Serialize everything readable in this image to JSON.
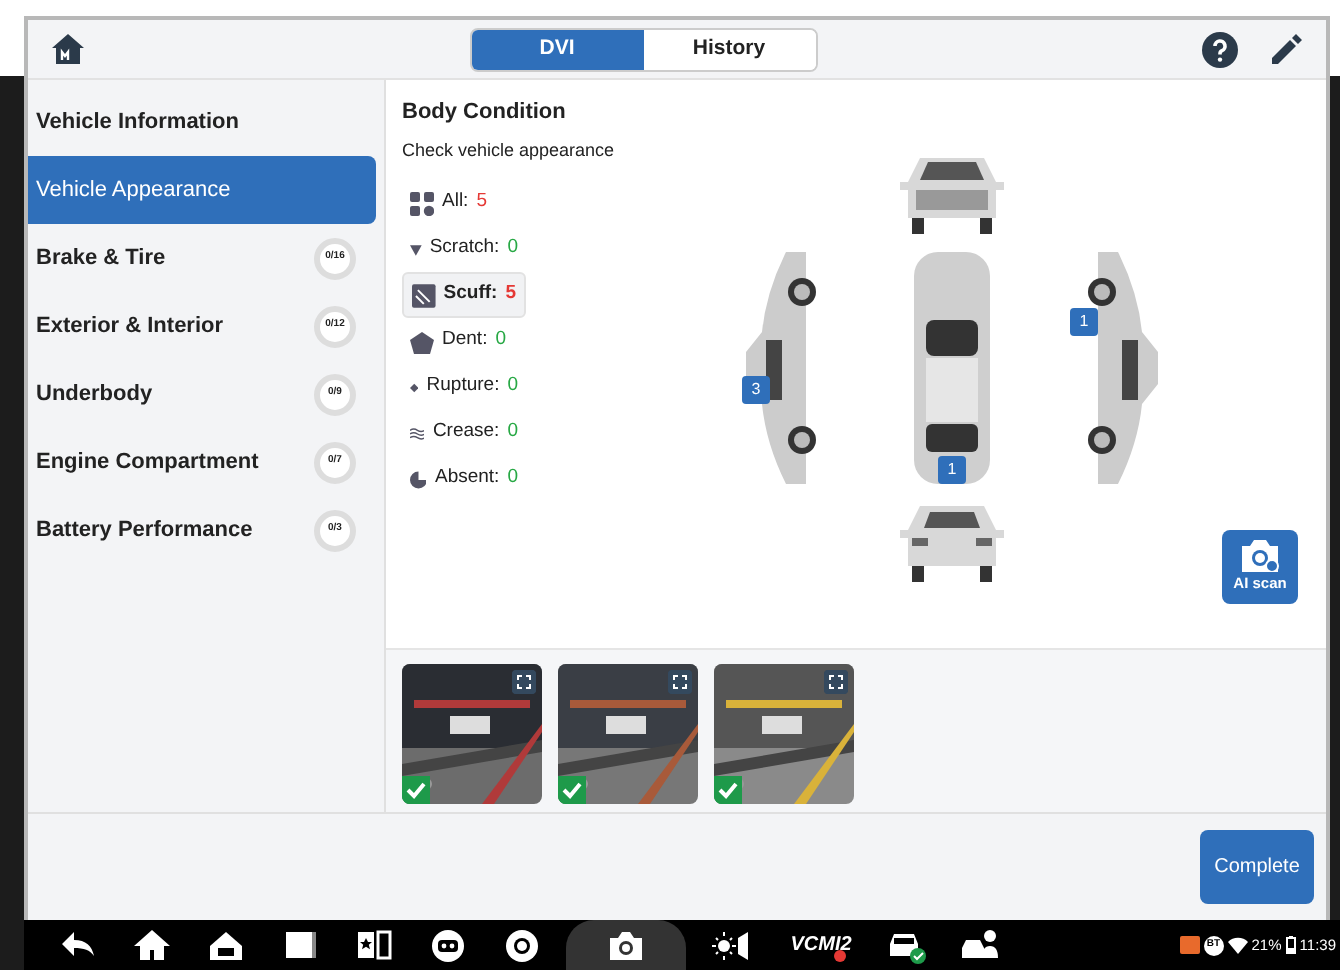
{
  "header": {
    "tabs": [
      {
        "label": "DVI",
        "selected": true
      },
      {
        "label": "History",
        "selected": false
      }
    ]
  },
  "sidebar": {
    "items": [
      {
        "label": "Vehicle Information",
        "selected": false
      },
      {
        "label": "Vehicle Appearance",
        "selected": true
      },
      {
        "label": "Brake & Tire",
        "selected": false,
        "progress": "0/16"
      },
      {
        "label": "Exterior & Interior",
        "selected": false,
        "progress": "0/12"
      },
      {
        "label": "Underbody",
        "selected": false,
        "progress": "0/9"
      },
      {
        "label": "Engine Compartment",
        "selected": false,
        "progress": "0/7"
      },
      {
        "label": "Battery Performance",
        "selected": false,
        "progress": "0/3"
      }
    ]
  },
  "body_condition": {
    "title": "Body Condition",
    "subtitle": "Check vehicle appearance",
    "filters": [
      {
        "kind": "all",
        "label": "All:",
        "count": "5",
        "flagged": true,
        "selected": false
      },
      {
        "kind": "scratch",
        "label": "Scratch:",
        "count": "0",
        "flagged": false,
        "selected": false
      },
      {
        "kind": "scuff",
        "label": "Scuff:",
        "count": "5",
        "flagged": true,
        "selected": true
      },
      {
        "kind": "dent",
        "label": "Dent:",
        "count": "0",
        "flagged": false,
        "selected": false
      },
      {
        "kind": "rupture",
        "label": "Rupture:",
        "count": "0",
        "flagged": false,
        "selected": false
      },
      {
        "kind": "crease",
        "label": "Crease:",
        "count": "0",
        "flagged": false,
        "selected": false
      },
      {
        "kind": "absent",
        "label": "Absent:",
        "count": "0",
        "flagged": false,
        "selected": false
      }
    ],
    "views": [
      {
        "kind": "front"
      },
      {
        "kind": "left",
        "marker": "3"
      },
      {
        "kind": "top",
        "marker": "1"
      },
      {
        "kind": "right",
        "marker": "1"
      },
      {
        "kind": "rear"
      }
    ],
    "ai_scan": {
      "label": "AI scan"
    }
  },
  "photos": [
    {
      "kind": "picture",
      "checked": true
    },
    {
      "kind": "picture",
      "checked": true
    },
    {
      "kind": "picture",
      "checked": true
    }
  ],
  "complete_button": {
    "label": "Complete"
  },
  "taskbar": {
    "items": [
      {
        "kind": "back"
      },
      {
        "kind": "home"
      },
      {
        "kind": "garage"
      },
      {
        "kind": "square"
      },
      {
        "kind": "star-panel"
      },
      {
        "kind": "robot"
      },
      {
        "kind": "browser"
      },
      {
        "kind": "camera"
      },
      {
        "kind": "brightness"
      },
      {
        "kind": "vci",
        "label": "VCMI2"
      },
      {
        "kind": "car-check"
      },
      {
        "kind": "person-car"
      }
    ],
    "status": {
      "bt": "BT",
      "battery": "21%",
      "time": "11:39"
    }
  }
}
